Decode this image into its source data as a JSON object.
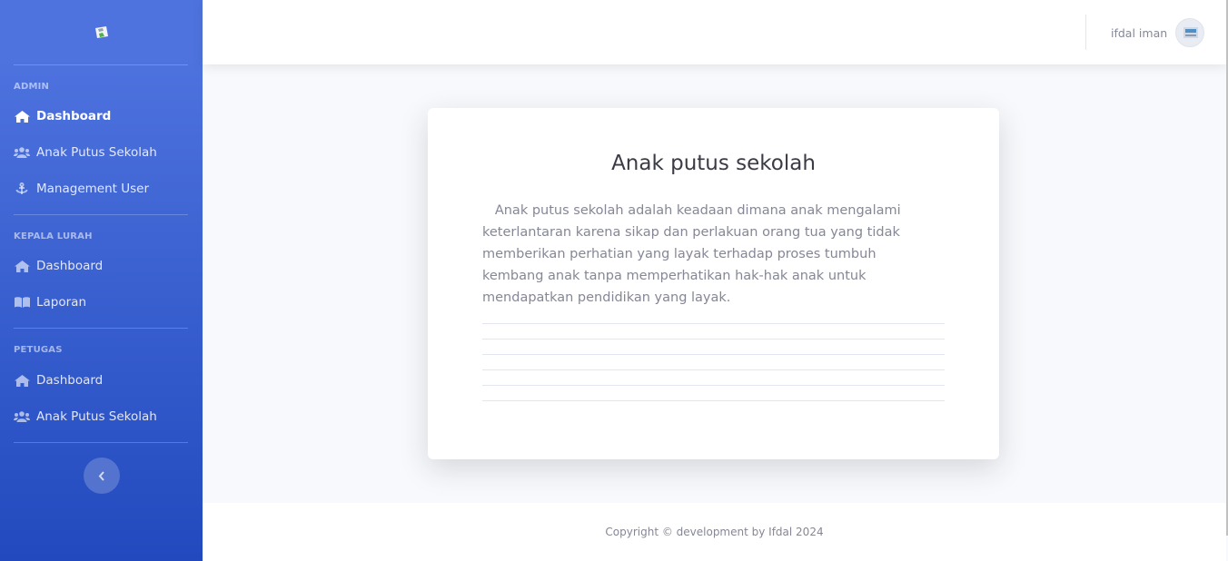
{
  "sidebar": {
    "sections": [
      {
        "heading": "ADMIN",
        "items": [
          {
            "label": "Dashboard",
            "icon": "home-icon"
          },
          {
            "label": "Anak Putus Sekolah",
            "icon": "users-icon"
          },
          {
            "label": "Management User",
            "icon": "anchor-icon"
          }
        ]
      },
      {
        "heading": "KEPALA LURAH",
        "items": [
          {
            "label": "Dashboard",
            "icon": "home-icon"
          },
          {
            "label": "Laporan",
            "icon": "book-icon"
          }
        ]
      },
      {
        "heading": "PETUGAS",
        "items": [
          {
            "label": "Dashboard",
            "icon": "home-icon"
          },
          {
            "label": "Anak Putus Sekolah",
            "icon": "users-icon"
          }
        ]
      }
    ],
    "toggle_icon": "chevron-left-icon"
  },
  "topbar": {
    "username": "ifdal iman"
  },
  "card": {
    "title": "Anak putus sekolah",
    "text": "Anak putus sekolah adalah keadaan dimana anak mengalami keterlantaran karena sikap dan perlakuan orang tua yang tidak memberikan perhatian yang layak terhadap proses tumbuh kembang anak tanpa memperhatikan hak-hak anak untuk mendapatkan pendidikan yang layak."
  },
  "footer": {
    "copyright": "Copyright © development by Ifdal 2024"
  },
  "colors": {
    "primary": "#4e73df",
    "primary_dark": "#224abe",
    "text_muted": "#858796"
  }
}
